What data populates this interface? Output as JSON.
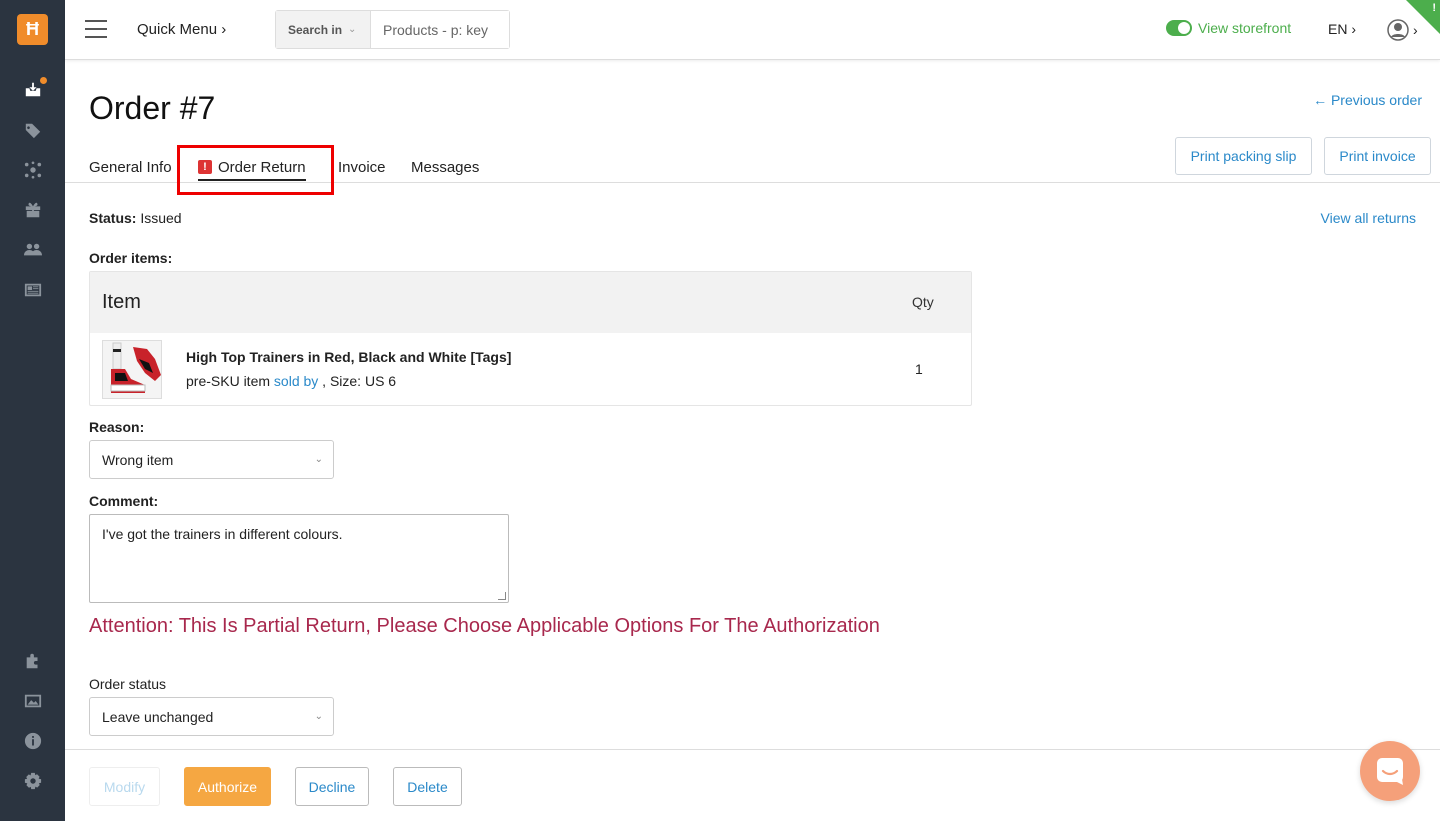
{
  "sidebar": {
    "logo": "Ħ"
  },
  "topbar": {
    "quick_menu": "Quick Menu ›",
    "search_in": "Search in",
    "search_placeholder": "Products - p: key",
    "storefront": "View storefront",
    "lang": "EN ›",
    "user_chevron": "›"
  },
  "page": {
    "title": "Order #7",
    "previous_order": "← Previous order"
  },
  "tabs": [
    {
      "label": "General Info"
    },
    {
      "label": "Order Return"
    },
    {
      "label": "Invoice"
    },
    {
      "label": "Messages"
    }
  ],
  "actions": {
    "print_packing_slip": "Print packing slip",
    "print_invoice": "Print invoice"
  },
  "status": {
    "label": "Status:",
    "value": "Issued",
    "view_all": "View all returns"
  },
  "items": {
    "label": "Order items:",
    "col_item": "Item",
    "col_qty": "Qty",
    "rows": [
      {
        "name": "High Top Trainers in Red, Black and White [Tags]",
        "sku_prefix": "pre-SKU item",
        "sold_by": "sold by",
        "size": ", Size: US 6",
        "qty": "1"
      }
    ]
  },
  "reason": {
    "label": "Reason:",
    "value": "Wrong item"
  },
  "comment": {
    "label": "Comment:",
    "value": "I've got the trainers in different colours."
  },
  "attention": "Attention: This Is Partial Return, Please Choose Applicable Options For The Authorization",
  "order_status": {
    "label": "Order status",
    "value": "Leave unchanged"
  },
  "footer": {
    "modify": "Modify",
    "authorize": "Authorize",
    "decline": "Decline",
    "delete": "Delete"
  },
  "colors": {
    "accent": "#2a89c9",
    "orange": "#f5a742",
    "sidebar": "#2b3440",
    "alert": "#a8284d",
    "green": "#4cae4c"
  }
}
